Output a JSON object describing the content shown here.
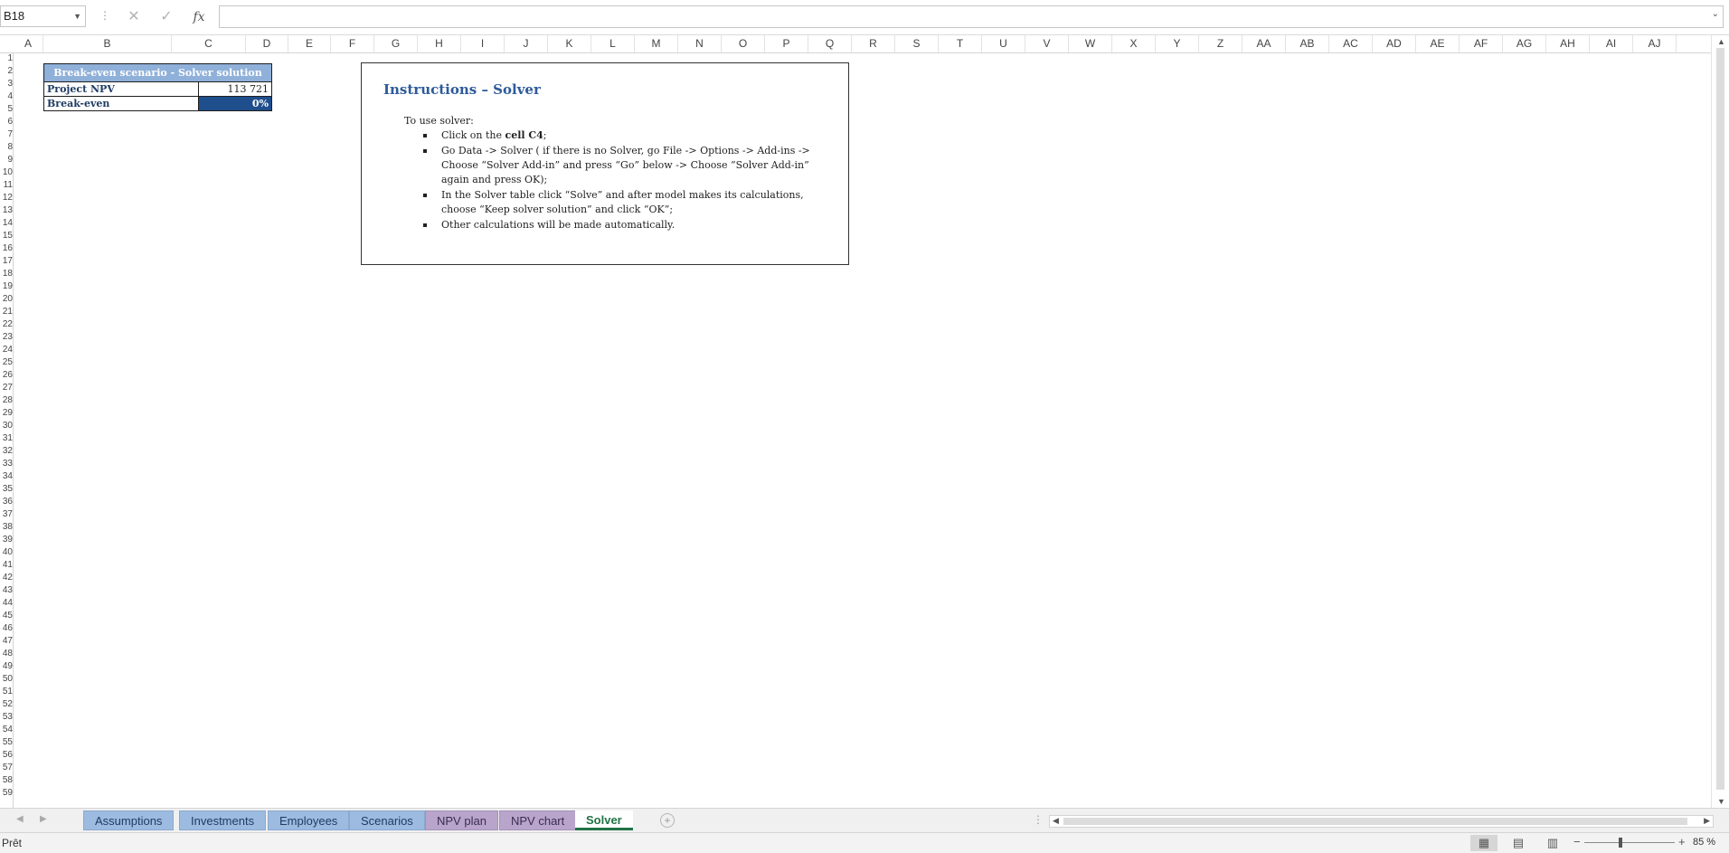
{
  "formula_bar": {
    "name_box": "B18",
    "cancel_icon": "✕",
    "enter_icon": "✓",
    "fx_label": "fx",
    "formula_value": ""
  },
  "columns": [
    "A",
    "B",
    "C",
    "D",
    "E",
    "F",
    "G",
    "H",
    "I",
    "J",
    "K",
    "L",
    "M",
    "N",
    "O",
    "P",
    "Q",
    "R",
    "S",
    "T",
    "U",
    "V",
    "W",
    "X",
    "Y",
    "Z",
    "AA",
    "AB",
    "AC",
    "AD",
    "AE",
    "AF",
    "AG",
    "AH",
    "AI",
    "AJ"
  ],
  "rows": [
    "1",
    "2",
    "3",
    "4",
    "5",
    "6",
    "7",
    "8",
    "9",
    "10",
    "11",
    "12",
    "13",
    "14",
    "15",
    "16",
    "17",
    "18",
    "19",
    "20",
    "21",
    "22",
    "23",
    "24",
    "25",
    "26",
    "27",
    "28",
    "29",
    "30",
    "31",
    "32",
    "33",
    "34",
    "35",
    "36",
    "37",
    "38",
    "39",
    "40",
    "41",
    "42",
    "43",
    "44",
    "45",
    "46",
    "47",
    "48",
    "49",
    "50",
    "51",
    "52",
    "53",
    "54",
    "55",
    "56",
    "57",
    "58",
    "59"
  ],
  "breakeven": {
    "title": "Break-even scenario - Solver solution",
    "npv_label": "Project NPV",
    "npv_value": "113 721",
    "be_label": "Break-even",
    "be_value": "0%"
  },
  "instructions": {
    "title": "Instructions – Solver",
    "intro": "To use solver:",
    "item1_prefix": "Click on the ",
    "item1_bold": "cell C4",
    "item1_suffix": ";",
    "item2": "Go Data -> Solver ( if there is no Solver, go File -> Options -> Add-ins -> Choose “Solver Add-in” and press “Go” below -> Choose “Solver Add-in” again and press OK);",
    "item3": "In the Solver table click “Solve” and after model makes its calculations, choose “Keep solver solution” and click “OK”;",
    "item4": "Other calculations will be made automatically."
  },
  "tabs": [
    {
      "label": "Assumptions",
      "style": "blue"
    },
    {
      "label": "Investments",
      "style": "blue"
    },
    {
      "label": "Employees",
      "style": "blue"
    },
    {
      "label": "Scenarios",
      "style": "blue"
    },
    {
      "label": "NPV plan",
      "style": "purple"
    },
    {
      "label": "NPV chart",
      "style": "purple"
    },
    {
      "label": "Solver",
      "style": "active"
    }
  ],
  "status": {
    "ready": "Prêt",
    "zoom": "85 %"
  },
  "colors": {
    "tab_blue": "#9dbbe0",
    "tab_purple": "#b9a5cc",
    "accent": "#217346",
    "table_dark": "#1f4e8c"
  }
}
